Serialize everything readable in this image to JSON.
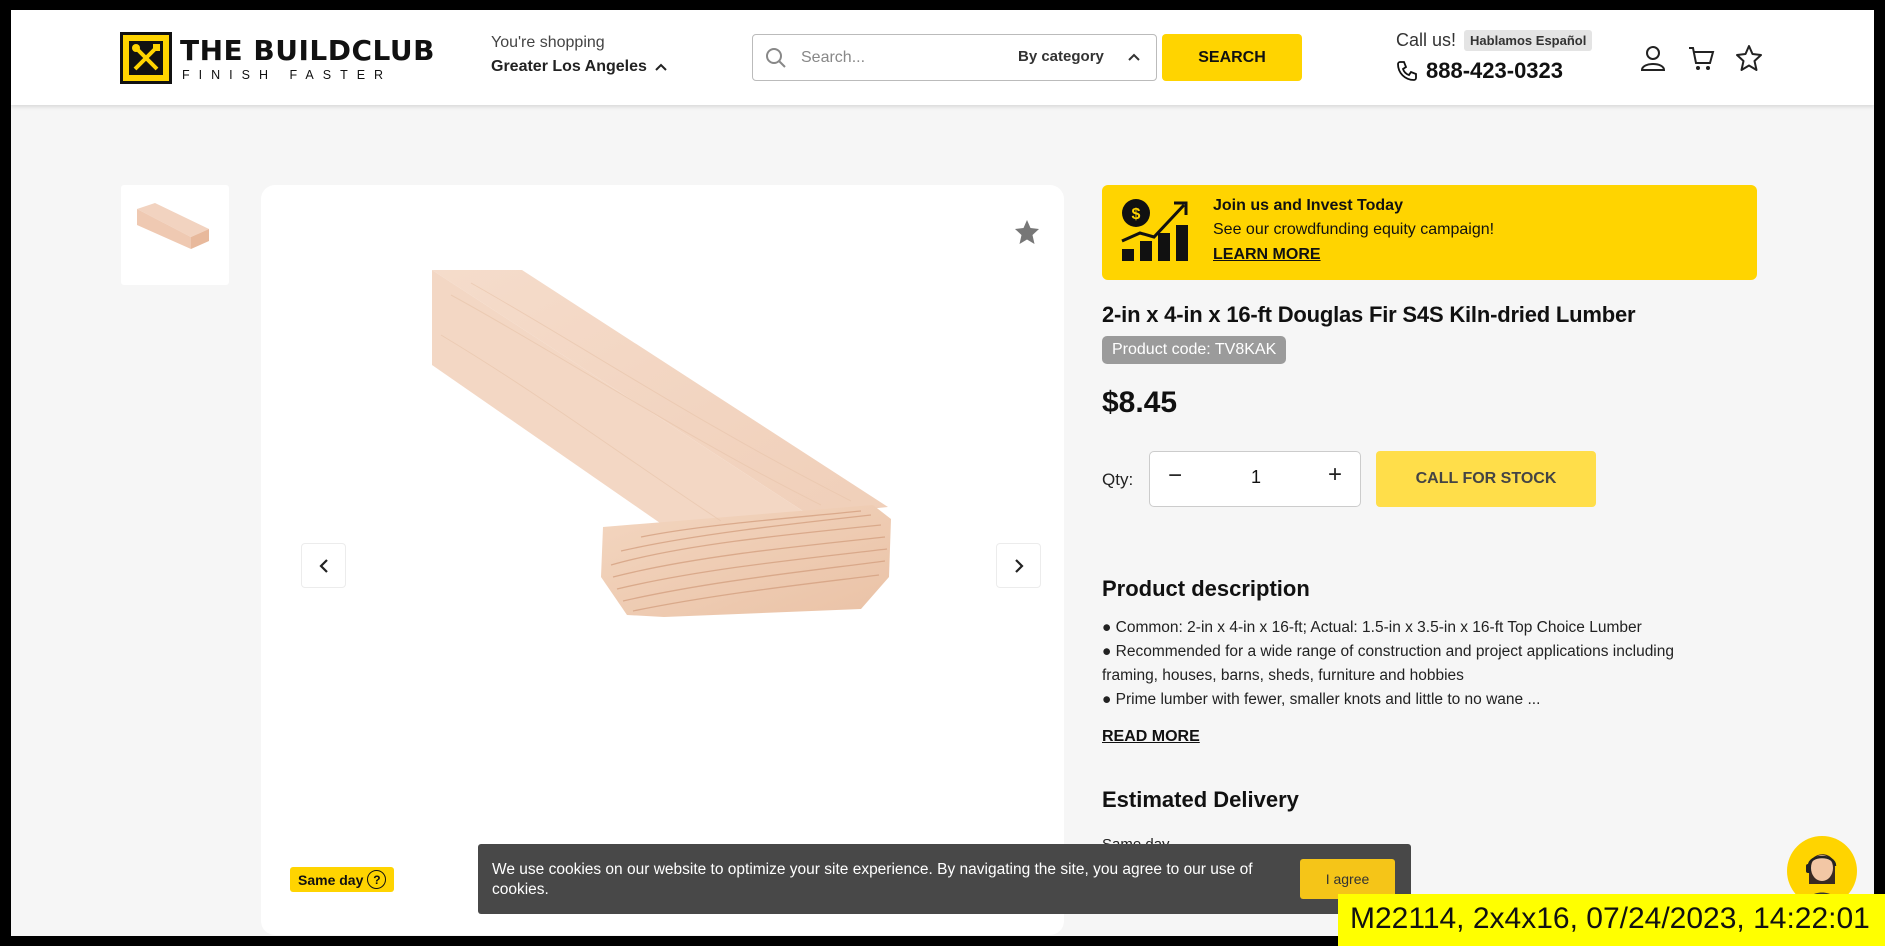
{
  "header": {
    "logo_text": "THE BUILDCLUB",
    "logo_tagline": "FINISH FASTER",
    "shopping_label": "You're shopping",
    "shopping_location": "Greater Los Angeles",
    "search": {
      "placeholder": "Search...",
      "category": "By category",
      "button_label": "SEARCH"
    },
    "call_label": "Call us!",
    "language_badge": "Hablamos Español",
    "phone": "888-423-0323",
    "icons": [
      "user-icon",
      "cart-icon",
      "star-icon"
    ]
  },
  "promo": {
    "title": "Join us and Invest Today",
    "subtitle": "See our crowdfunding equity campaign!",
    "link": "LEARN MORE"
  },
  "product": {
    "title": "2-in x 4-in x 16-ft Douglas Fir S4S Kiln-dried Lumber",
    "code": "Product code: TV8KAK",
    "price": "$8.45",
    "qty_label": "Qty:",
    "qty_value": "1",
    "qty_minus": "−",
    "qty_plus": "+",
    "cta": "CALL FOR STOCK",
    "same_day_badge": "Same day"
  },
  "description": {
    "heading": "Product description",
    "items": [
      "● Common: 2-in x 4-in x 16-ft; Actual: 1.5-in x 3.5-in x 16-ft Top Choice Lumber",
      "● Recommended for a wide range of construction and project applications including framing, houses, barns, sheds, furniture and hobbies",
      "● Prime lumber with fewer, smaller knots and little to no wane ..."
    ],
    "read_more": "READ MORE"
  },
  "delivery": {
    "heading": "Estimated Delivery",
    "value": "Same day"
  },
  "cookie": {
    "text": "We use cookies on our website to optimize your site experience. By navigating the site, you agree to our use of cookies.",
    "button": "I agree"
  },
  "overlay_caption": "M22114, 2x4x16, 07/24/2023, 14:22:01",
  "colors": {
    "accent": "#ffd400",
    "cookie_bg": "#484848",
    "page_bg": "#f6f6f6"
  }
}
